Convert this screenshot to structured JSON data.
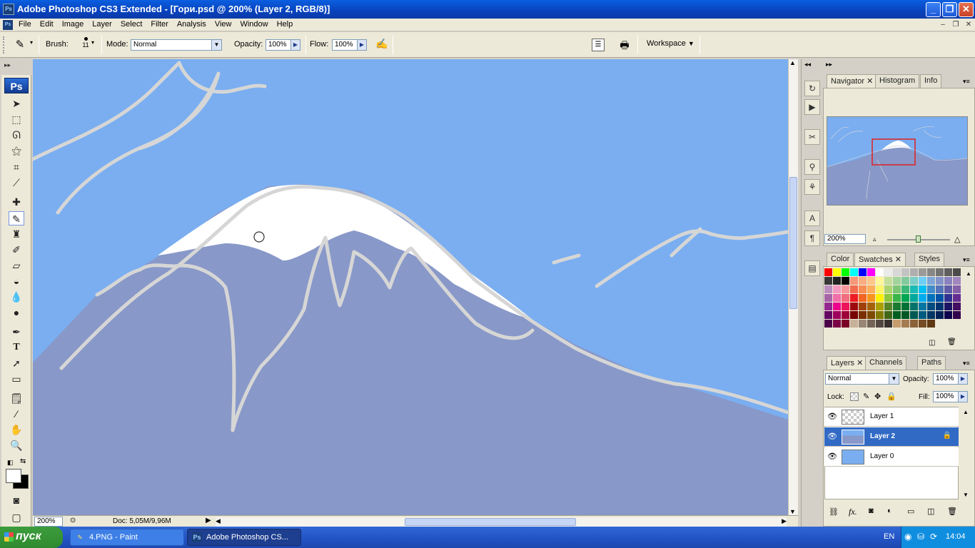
{
  "window": {
    "app_icon": "Ps",
    "title": "Adobe Photoshop CS3 Extended - [Гори.psd @ 200% (Layer 2, RGB/8)]"
  },
  "menu": [
    "File",
    "Edit",
    "Image",
    "Layer",
    "Select",
    "Filter",
    "Analysis",
    "View",
    "Window",
    "Help"
  ],
  "options": {
    "brush_label": "Brush:",
    "brush_size": "11",
    "mode_label": "Mode:",
    "mode_value": "Normal",
    "opacity_label": "Opacity:",
    "opacity_value": "100%",
    "flow_label": "Flow:",
    "flow_value": "100%",
    "workspace_label": "Workspace"
  },
  "toolbox": {
    "logo": "Ps",
    "tools": [
      "move",
      "marquee",
      "lasso",
      "magic-wand",
      "crop",
      "slice",
      "healing",
      "brush",
      "clone-stamp",
      "history-brush",
      "eraser",
      "paint-bucket",
      "blur",
      "dodge",
      "pen",
      "type",
      "path-select",
      "shape",
      "notes",
      "eyedropper",
      "hand",
      "zoom"
    ],
    "active_tool": "brush",
    "type_glyph": "T"
  },
  "status": {
    "zoom": "200%",
    "doc": "Doc: 5,05M/9,96M"
  },
  "navigator": {
    "tabs": [
      "Navigator",
      "Histogram",
      "Info"
    ],
    "zoom": "200%"
  },
  "swatches": {
    "tabs": [
      "Color",
      "Swatches",
      "Styles"
    ],
    "colors": [
      "#ff0000",
      "#ffff00",
      "#00ff00",
      "#00ffff",
      "#0000ff",
      "#ff00ff",
      "#ffffff",
      "#ebebeb",
      "#d7d7d7",
      "#c3c3c3",
      "#afafaf",
      "#9b9b9b",
      "#878787",
      "#737373",
      "#5f5f5f",
      "#4b4b4b",
      "#373737",
      "#232323",
      "#000000",
      "#f7977a",
      "#f9ad81",
      "#fdc68a",
      "#fff79a",
      "#c4df9b",
      "#a2d39c",
      "#82ca9d",
      "#7bcdc8",
      "#6ecff6",
      "#7ea7d8",
      "#8493ca",
      "#8882be",
      "#a187be",
      "#bc8dbf",
      "#f49ac2",
      "#f6989d",
      "#f26c4f",
      "#f68e55",
      "#fbaf5c",
      "#fff467",
      "#acd372",
      "#7cc576",
      "#3bb878",
      "#1abbb4",
      "#00bff3",
      "#438ccb",
      "#5574b9",
      "#605ca8",
      "#855fa8",
      "#a763a8",
      "#f06ea9",
      "#f26d7d",
      "#ed1c24",
      "#f26522",
      "#f7941d",
      "#fff200",
      "#8dc73f",
      "#39b54a",
      "#00a651",
      "#00a99d",
      "#00aeef",
      "#0072bc",
      "#0054a6",
      "#2e3192",
      "#662d91",
      "#92278f",
      "#ec008c",
      "#ed145b",
      "#9e0b0f",
      "#a0410d",
      "#a3620a",
      "#aba000",
      "#598527",
      "#1a7b30",
      "#007236",
      "#00746b",
      "#0076a3",
      "#004b80",
      "#003471",
      "#1b1464",
      "#440e62",
      "#630460",
      "#9e005d",
      "#9e0039",
      "#790000",
      "#7b2e00",
      "#7d4900",
      "#827b00",
      "#406618",
      "#005e20",
      "#005826",
      "#005952",
      "#005b7f",
      "#003663",
      "#002157",
      "#0d004c",
      "#32004b",
      "#4b0049",
      "#7b0046",
      "#7a0026",
      "#c7b299",
      "#998675",
      "#736357",
      "#534741",
      "#37302d",
      "#c69c6d",
      "#a67c52",
      "#8c6239",
      "#754c24",
      "#603913"
    ]
  },
  "layers": {
    "tabs": [
      "Layers",
      "Channels",
      "Paths"
    ],
    "blend": "Normal",
    "opacity_label": "Opacity:",
    "opacity_value": "100%",
    "lock_label": "Lock:",
    "fill_label": "Fill:",
    "fill_value": "100%",
    "items": [
      {
        "name": "Layer 1",
        "thumb": "transparent"
      },
      {
        "name": "Layer 2",
        "thumb": "mountain",
        "selected": true
      },
      {
        "name": "Layer 0",
        "thumb": "sky"
      }
    ]
  },
  "taskbar": {
    "start": "пуск",
    "tasks": [
      {
        "label": "4.PNG - Paint",
        "icon": "paint-icon"
      },
      {
        "label": "Adobe Photoshop CS...",
        "icon": "photoshop-icon",
        "active": true
      }
    ],
    "lang": "EN",
    "time": "14:04"
  },
  "colors": {
    "sky": "#7aaef0",
    "mountain": "#8898c8",
    "stroke": "#d6d6d6",
    "snow": "#ffffff",
    "selection": "#316ac5"
  }
}
